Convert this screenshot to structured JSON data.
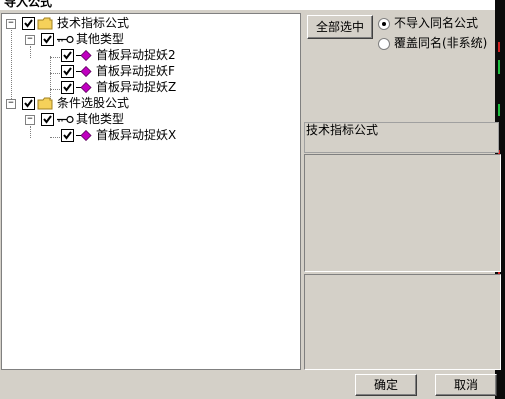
{
  "window": {
    "title": "导入公式"
  },
  "tree": {
    "nodes": [
      {
        "label": "技术指标公式",
        "expander": "−"
      },
      {
        "label": "其他类型",
        "expander": "−"
      },
      {
        "label": "首板异动捉妖2"
      },
      {
        "label": "首板异动捉妖F"
      },
      {
        "label": "首板异动捉妖Z"
      },
      {
        "label": "条件选股公式",
        "expander": "−"
      },
      {
        "label": "其他类型",
        "expander": "−"
      },
      {
        "label": "首板异动捉妖X"
      }
    ]
  },
  "buttons": {
    "select_all": "全部选中",
    "ok": "确定",
    "cancel": "取消"
  },
  "options": {
    "no_import_same": "不导入同名公式",
    "overwrite_same": "覆盖同名(非系统)",
    "selected": "no_import_same"
  },
  "info": {
    "type_label": "技术指标公式"
  },
  "icons": {
    "folder": "folder-icon",
    "key": "key-icon",
    "formula": "formula-diamond-icon",
    "check": "checkmark-icon"
  },
  "colors": {
    "folder": "#f5d15a",
    "formula_diamond": "#c000c0",
    "edge_markers": [
      "#d02020",
      "#20c040"
    ]
  }
}
